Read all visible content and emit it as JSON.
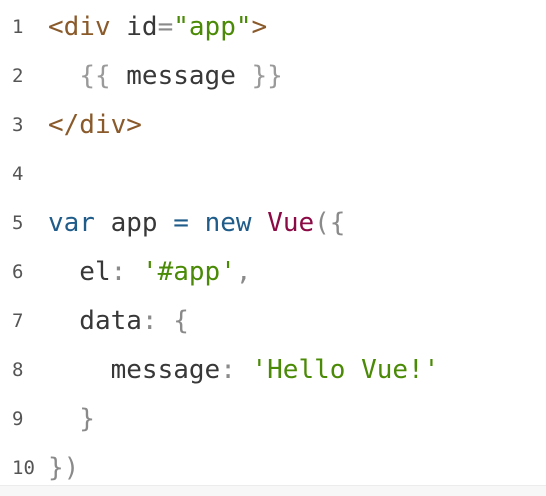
{
  "code": {
    "lines": [
      {
        "number": "1",
        "segments": [
          {
            "t": "<div",
            "c": "t-markup"
          },
          {
            "t": " id",
            "c": "t-attr"
          },
          {
            "t": "=",
            "c": "t-punct"
          },
          {
            "t": "\"app\"",
            "c": "t-string"
          },
          {
            "t": ">",
            "c": "t-markup"
          }
        ]
      },
      {
        "number": "2",
        "segments": [
          {
            "t": "  ",
            "c": "t-plain"
          },
          {
            "t": "{{ ",
            "c": "t-muted"
          },
          {
            "t": "message",
            "c": "t-plain"
          },
          {
            "t": " }}",
            "c": "t-muted"
          }
        ]
      },
      {
        "number": "3",
        "segments": [
          {
            "t": "</div>",
            "c": "t-markup"
          }
        ]
      },
      {
        "number": "4",
        "segments": []
      },
      {
        "number": "5",
        "segments": [
          {
            "t": "var",
            "c": "t-keyword"
          },
          {
            "t": " app ",
            "c": "t-plain"
          },
          {
            "t": "=",
            "c": "t-keyword"
          },
          {
            "t": " ",
            "c": "t-plain"
          },
          {
            "t": "new",
            "c": "t-keyword"
          },
          {
            "t": " ",
            "c": "t-plain"
          },
          {
            "t": "Vue",
            "c": "t-class"
          },
          {
            "t": "({",
            "c": "t-punct"
          }
        ]
      },
      {
        "number": "6",
        "segments": [
          {
            "t": "  el",
            "c": "t-plain"
          },
          {
            "t": ": ",
            "c": "t-punct"
          },
          {
            "t": "'#app'",
            "c": "t-string"
          },
          {
            "t": ",",
            "c": "t-punct"
          }
        ]
      },
      {
        "number": "7",
        "segments": [
          {
            "t": "  data",
            "c": "t-plain"
          },
          {
            "t": ": {",
            "c": "t-punct"
          }
        ]
      },
      {
        "number": "8",
        "segments": [
          {
            "t": "    message",
            "c": "t-plain"
          },
          {
            "t": ": ",
            "c": "t-punct"
          },
          {
            "t": "'Hello Vue!'",
            "c": "t-string"
          }
        ]
      },
      {
        "number": "9",
        "segments": [
          {
            "t": "  }",
            "c": "t-punct"
          }
        ]
      },
      {
        "number": "10",
        "segments": [
          {
            "t": "})",
            "c": "t-punct"
          }
        ]
      }
    ]
  },
  "colors": {
    "markup": "#8a5a2b",
    "string": "#4a8a06",
    "keyword": "#1f5c8a",
    "class": "#8b0a45",
    "muted": "#9a9a9a",
    "gutter": "#555555"
  }
}
